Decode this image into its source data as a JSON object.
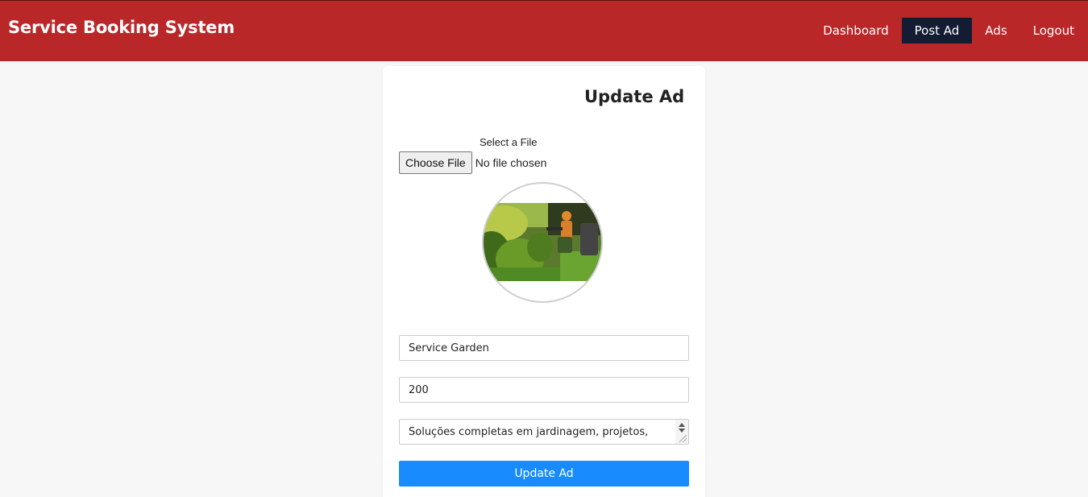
{
  "navbar": {
    "brand": "Service Booking System",
    "links": [
      "Dashboard",
      "Post Ad",
      "Ads",
      "Logout"
    ],
    "active": "Post Ad",
    "colors": {
      "bar": "#ba2729",
      "active": "#141c33"
    }
  },
  "form": {
    "title": "Update Ad",
    "file_label": "Select a File",
    "file_button": "Choose File",
    "file_status": "No file chosen",
    "image": "gardener-trimming-hedges",
    "service_name": "Service Garden",
    "price": "200",
    "description": "Soluções completas em jardinagem, projetos,",
    "submit_label": "Update Ad",
    "submit_color": "#188cff"
  }
}
